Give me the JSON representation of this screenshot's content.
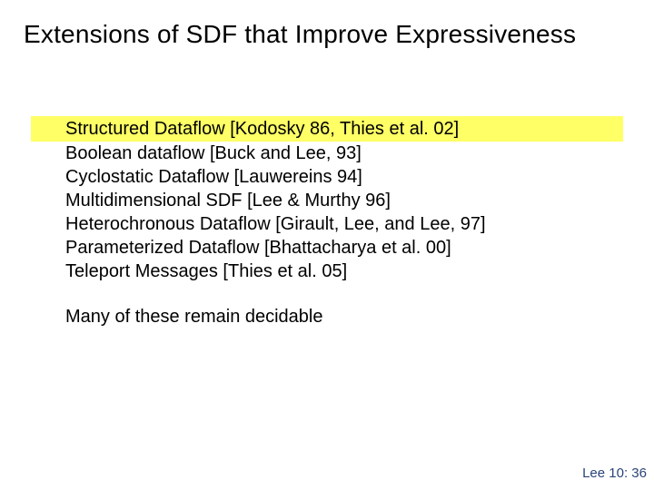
{
  "title": "Extensions of SDF that Improve Expressiveness",
  "items": [
    "Structured Dataflow [Kodosky 86, Thies et al. 02]",
    "Boolean dataflow [Buck and Lee, 93]",
    "Cyclostatic Dataflow [Lauwereins 94]",
    "Multidimensional SDF [Lee & Murthy 96]",
    "Heterochronous Dataflow [Girault, Lee, and Lee, 97]",
    "Parameterized Dataflow [Bhattacharya et al. 00]",
    "Teleport Messages [Thies et al. 05]"
  ],
  "note": "Many of these remain decidable",
  "footer": "Lee 10: 36"
}
